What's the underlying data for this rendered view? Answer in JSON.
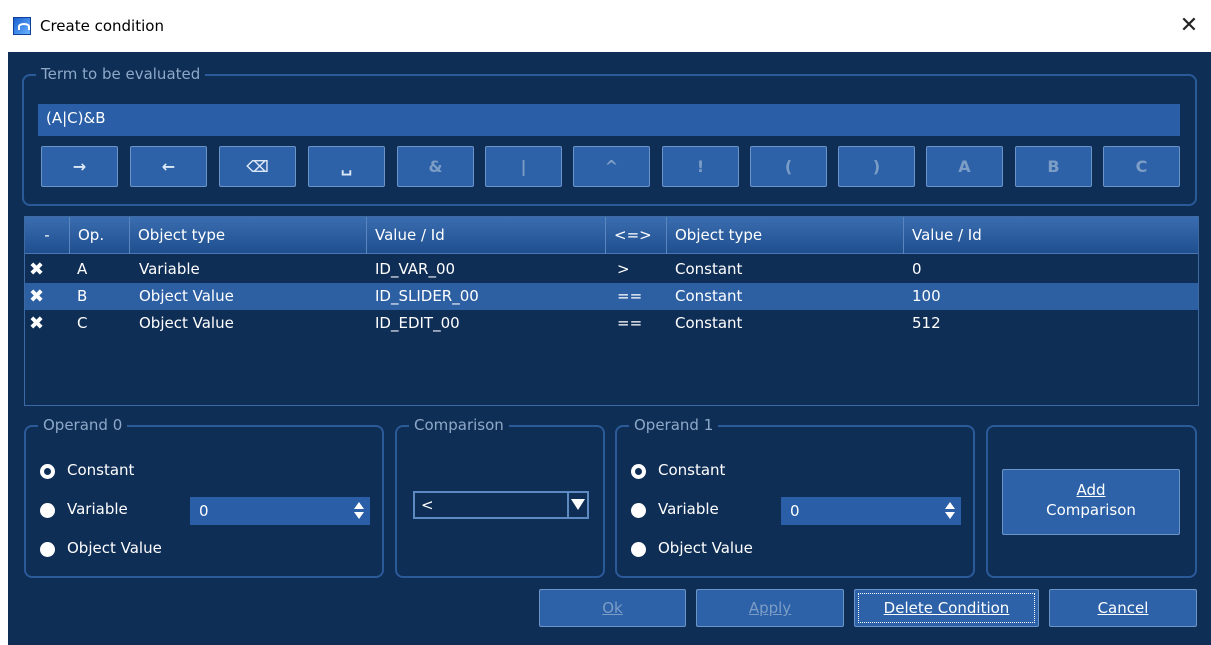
{
  "window": {
    "title": "Create condition",
    "close": "✕"
  },
  "term": {
    "label": "Term to be evaluated",
    "expression": "(A|C)&B",
    "buttons": [
      {
        "label": "→",
        "icon": "arrow-right-icon"
      },
      {
        "label": "←",
        "icon": "arrow-left-icon"
      },
      {
        "label": "⌫",
        "icon": "backspace-icon"
      },
      {
        "label": "␣",
        "icon": "space-icon"
      },
      {
        "label": "&"
      },
      {
        "label": "|"
      },
      {
        "label": "^"
      },
      {
        "label": "!"
      },
      {
        "label": "("
      },
      {
        "label": ")"
      },
      {
        "label": "A"
      },
      {
        "label": "B"
      },
      {
        "label": "C"
      }
    ]
  },
  "table": {
    "headers": [
      "-",
      "Op.",
      "Object type",
      "Value / Id",
      "<=>",
      "Object type",
      "Value / Id"
    ],
    "rows": [
      {
        "op": "A",
        "type1": "Variable",
        "value1": "ID_VAR_00",
        "cmp": ">",
        "type2": "Constant",
        "value2": "0",
        "selected": false
      },
      {
        "op": "B",
        "type1": "Object Value",
        "value1": "ID_SLIDER_00",
        "cmp": "==",
        "type2": "Constant",
        "value2": "100",
        "selected": true
      },
      {
        "op": "C",
        "type1": "Object Value",
        "value1": "ID_EDIT_00",
        "cmp": "==",
        "type2": "Constant",
        "value2": "512",
        "selected": false
      }
    ],
    "delete_glyph": "✖"
  },
  "operand0": {
    "label": "Operand 0",
    "options": [
      "Constant",
      "Variable",
      "Object Value"
    ],
    "selected": "Constant",
    "spin_value": "0"
  },
  "comparison": {
    "label": "Comparison",
    "value": "<"
  },
  "operand1": {
    "label": "Operand 1",
    "options": [
      "Constant",
      "Variable",
      "Object Value"
    ],
    "selected": "Constant",
    "spin_value": "0"
  },
  "actions": {
    "add_comparison_line1": "Add",
    "add_comparison_line2": "Comparison",
    "ok": "Ok",
    "apply": "Apply",
    "delete_condition": "Delete Condition",
    "cancel": "Cancel"
  },
  "colors": {
    "background": "#0f2e56",
    "accent": "#2d62a8",
    "border": "#2a5a98",
    "selected_row": "#2d5fa3"
  }
}
